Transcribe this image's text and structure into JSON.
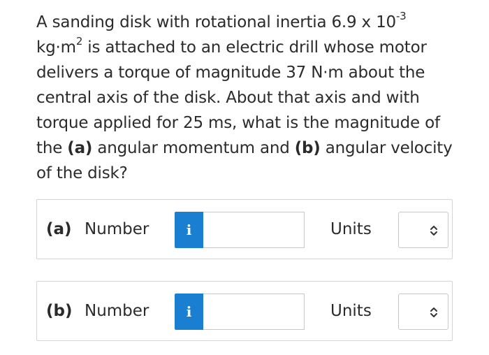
{
  "question": {
    "intro": "A sanding disk with rotational inertia 6.9 x 10",
    "exponent": "-3",
    "unit_prefix": "kg·m",
    "unit_exp": "2",
    "body_1": " is attached to an electric drill whose motor delivers a torque of magnitude 37 N·m about the central axis of the disk. About that axis and with torque applied for 25 ms, what is the magnitude of the ",
    "part_a_marker": "(a)",
    "body_2": " angular momentum and ",
    "part_b_marker": "(b)",
    "body_3": " angular velocity of the disk?"
  },
  "answers": [
    {
      "part": "(a)",
      "number_label": "Number",
      "info_icon": "i",
      "number_value": "",
      "units_label": "Units",
      "units_selected": ""
    },
    {
      "part": "(b)",
      "number_label": "Number",
      "info_icon": "i",
      "number_value": "",
      "units_label": "Units",
      "units_selected": ""
    }
  ],
  "colors": {
    "info_button": "#1b7fd1",
    "text": "#2b2b2b",
    "border": "#d4d4d4"
  },
  "icons": {
    "info": "info-icon",
    "select": "up-down-chevron-icon"
  }
}
